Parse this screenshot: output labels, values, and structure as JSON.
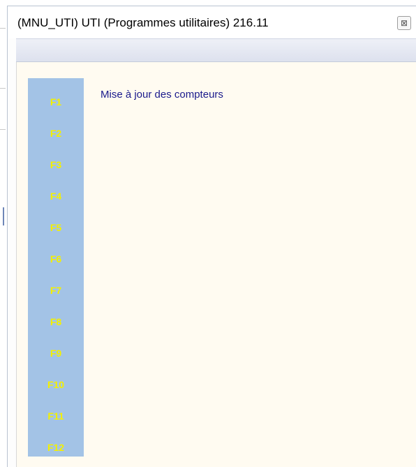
{
  "window": {
    "title": "(MNU_UTI) UTI (Programmes utilitaires) 216.11",
    "close_glyph": "⊠"
  },
  "function_keys": [
    "F1",
    "F2",
    "F3",
    "F4",
    "F5",
    "F6",
    "F7",
    "F8",
    "F9",
    "F10",
    "F11",
    "F12"
  ],
  "menu": {
    "items": [
      "Mise à jour des compteurs"
    ]
  },
  "colors": {
    "fkey_panel": "#a3c3e6",
    "fkey_text": "#f4f000",
    "content_bg": "#fffbf1",
    "menu_text": "#1a1a8c"
  }
}
